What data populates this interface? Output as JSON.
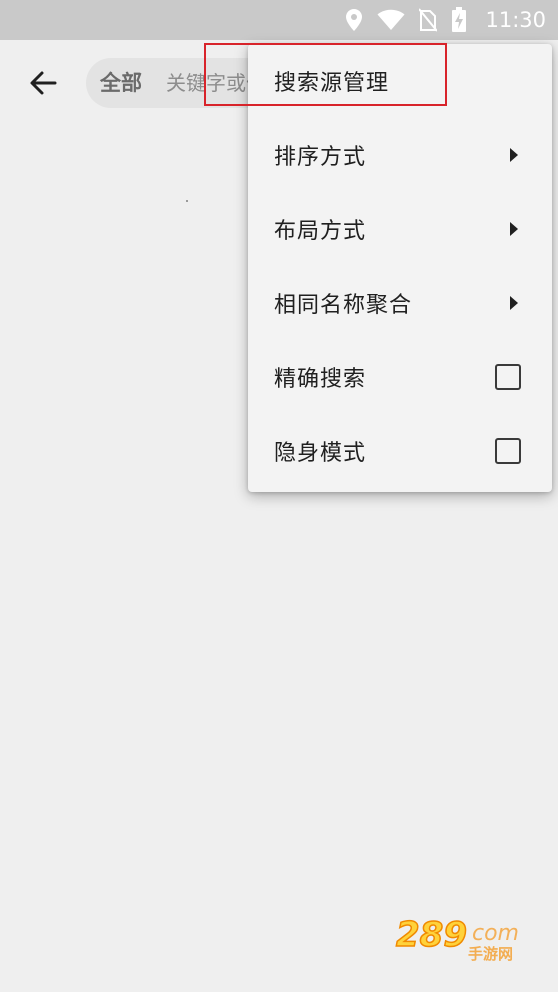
{
  "status_bar": {
    "time": "11:30",
    "icons": [
      "location-icon",
      "wifi-icon",
      "no-sim-icon",
      "battery-charging-icon"
    ]
  },
  "header": {
    "back_icon": "arrow-left-icon",
    "scope_label": "全部",
    "search_placeholder": "关键字或作者"
  },
  "menu": {
    "items": [
      {
        "label": "搜索源管理",
        "trailing": "none"
      },
      {
        "label": "排序方式",
        "trailing": "submenu-arrow-icon"
      },
      {
        "label": "布局方式",
        "trailing": "submenu-arrow-icon"
      },
      {
        "label": "相同名称聚合",
        "trailing": "submenu-arrow-icon"
      },
      {
        "label": "精确搜索",
        "trailing": "checkbox",
        "checked": false
      },
      {
        "label": "隐身模式",
        "trailing": "checkbox",
        "checked": false
      }
    ]
  },
  "annotation": {
    "color": "#d8232a",
    "target": "搜索源管理"
  },
  "watermark": {
    "text": "手游网"
  },
  "colors": {
    "background": "#efefef",
    "status_bar": "#c9c9c9",
    "menu_background": "#f3f3f3",
    "highlight": "#d8232a"
  }
}
